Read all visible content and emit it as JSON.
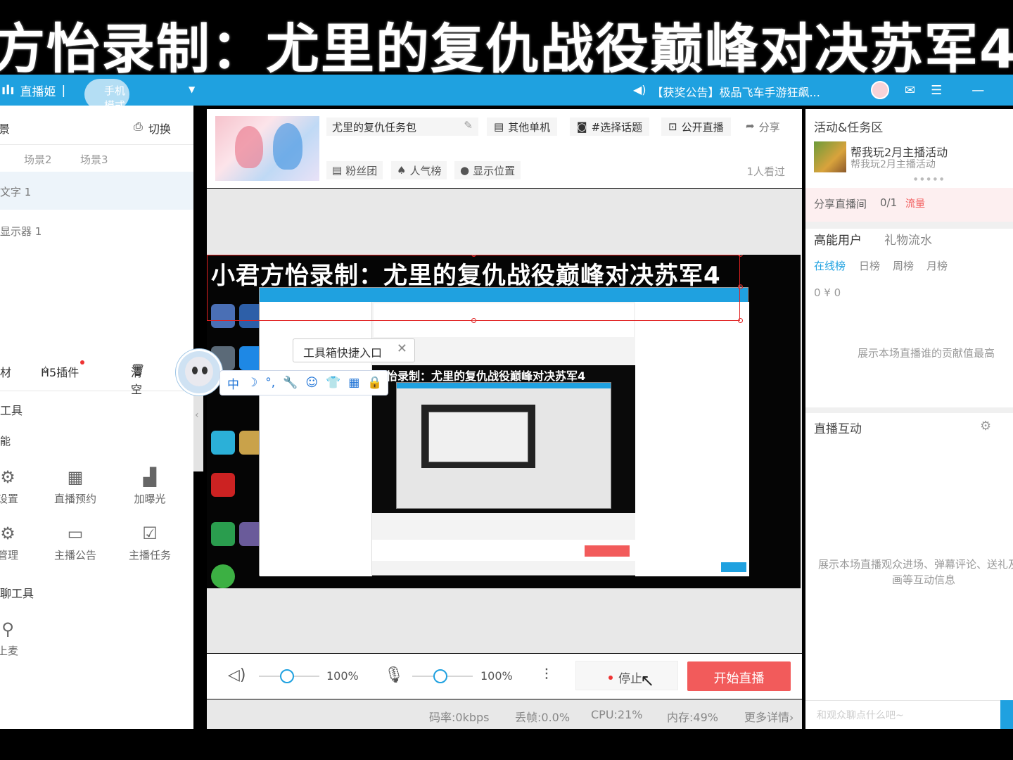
{
  "overlay": {
    "title": "方怡录制：尤里的复仇战役巅峰对决苏军4"
  },
  "topbar": {
    "app_name": "直播姬",
    "mode": "手机模式",
    "announcement": "【获奖公告】极品飞车手游狂飙...",
    "icons": [
      "volume-icon",
      "mail-icon",
      "menu-icon",
      "minimize-icon"
    ]
  },
  "left": {
    "scene_header": "景",
    "switch_label": "切换",
    "scenes": [
      "场景2",
      "场景3"
    ],
    "sources": [
      "文字 1",
      "显示器 1"
    ],
    "toolbar": {
      "material": "材",
      "h5": "H5插件",
      "clear": "清空"
    },
    "section_tools": "工具",
    "section_func": "能",
    "grid": [
      {
        "label": "设置",
        "icon": "gear-icon"
      },
      {
        "label": "直播预约",
        "icon": "calendar-icon"
      },
      {
        "label": "加曝光",
        "icon": "chart-icon"
      },
      {
        "label": "管理",
        "icon": "manage-icon"
      },
      {
        "label": "主播公告",
        "icon": "notice-icon"
      },
      {
        "label": "主播任务",
        "icon": "task-icon"
      }
    ],
    "section_chat": "聊工具",
    "chat_tool": "上麦"
  },
  "toolbox": {
    "tip": "工具箱快捷入口",
    "ime": [
      "中",
      "☽",
      "°,",
      "🔧",
      "☺",
      "👕",
      "▦",
      "🔒"
    ]
  },
  "info": {
    "room_title": "尤里的复仇任务包",
    "category": "其他单机",
    "topic": "#选择话题",
    "visibility": "公开直播",
    "share": "分享",
    "fans": "粉丝团",
    "popularity": "人气榜",
    "location": "显示位置",
    "watchers": "1人看过"
  },
  "preview": {
    "title": "小君方怡录制：尤里的复仇战役巅峰对决苏军4",
    "inner_title": "方怡录制：尤里的复仇战役巅峰对决苏军4"
  },
  "controls": {
    "speaker_pct": "100%",
    "mic_pct": "100%",
    "stop": "停止",
    "start": "开始直播"
  },
  "stats": {
    "bitrate": "码率:0kbps",
    "drop": "丢帧:0.0%",
    "cpu": "CPU:21%",
    "mem": "内存:49%",
    "more": "更多详情›"
  },
  "right": {
    "activity_header": "活动&任务区",
    "activity_title": "帮我玩2月主播活动",
    "activity_sub": "帮我玩2月主播活动",
    "share_label": "分享直播间",
    "share_count": "0/1",
    "share_reward": "流量",
    "tab_high": "高能用户",
    "tab_gift": "礼物流水",
    "subtabs": [
      "在线榜",
      "日榜",
      "周榜",
      "月榜"
    ],
    "counts": "0  ¥ 0",
    "empty1": "展示本场直播谁的贡献值最高",
    "interact_header": "直播互动",
    "empty2": "展示本场直播观众进场、弹幕评论、送礼及动画等互动信息",
    "chat_placeholder": "和观众聊点什么吧~"
  },
  "colors": {
    "accent": "#1fa1e0",
    "live": "#f25b5b"
  }
}
